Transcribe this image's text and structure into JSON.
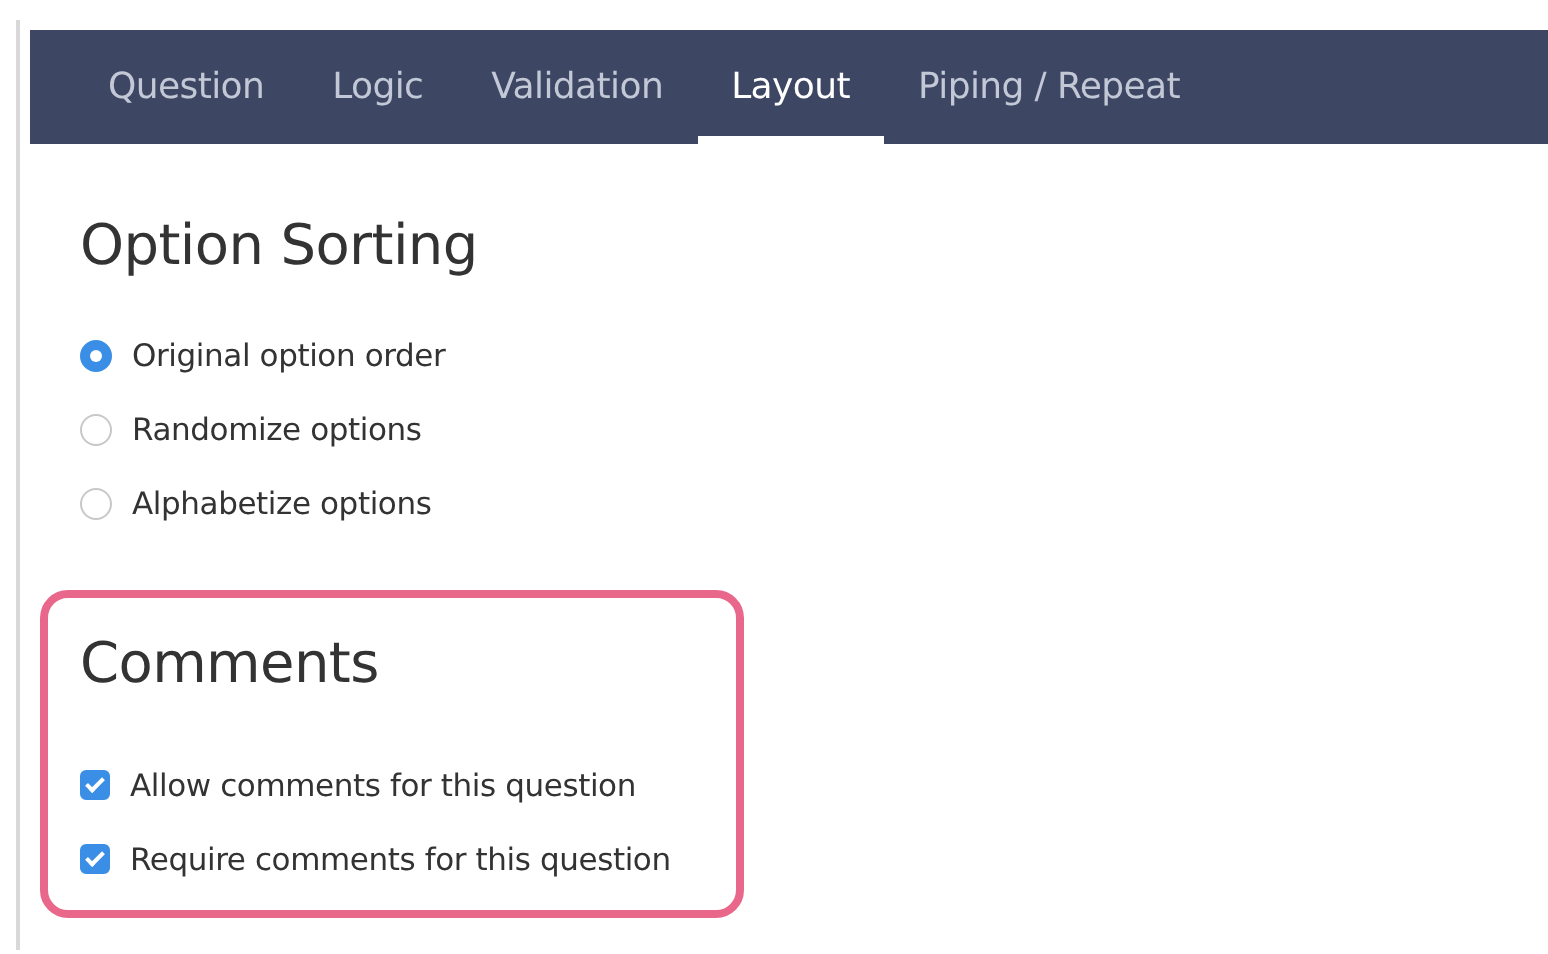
{
  "tabs": [
    {
      "label": "Question",
      "selected": false
    },
    {
      "label": "Logic",
      "selected": false
    },
    {
      "label": "Validation",
      "selected": false
    },
    {
      "label": "Layout",
      "selected": true
    },
    {
      "label": "Piping / Repeat",
      "selected": false
    }
  ],
  "option_sorting": {
    "title": "Option Sorting",
    "options": [
      {
        "label": "Original option order",
        "selected": true
      },
      {
        "label": "Randomize options",
        "selected": false
      },
      {
        "label": "Alphabetize options",
        "selected": false
      }
    ]
  },
  "comments": {
    "title": "Comments",
    "highlighted": true,
    "options": [
      {
        "label": "Allow comments for this question",
        "checked": true
      },
      {
        "label": "Require comments for this question",
        "checked": true
      }
    ]
  }
}
